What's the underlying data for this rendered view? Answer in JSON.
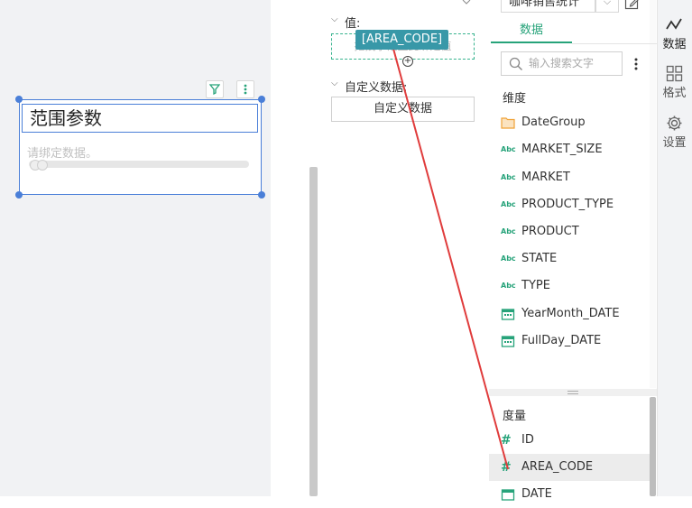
{
  "canvas": {
    "widget_title": "范围参数",
    "widget_placeholder": "请绑定数据。"
  },
  "binding_panel": {
    "value_label": "值:",
    "dropzone_placeholder": "拖拽字段至此绑定值",
    "custom_data_label": "自定义数据:",
    "custom_data_button": "自定义数据",
    "drag_chip": "[AREA_CODE]"
  },
  "data_panel": {
    "dataset": "咖啡销售统计",
    "tab_data": "数据",
    "search_placeholder": "输入搜索文字",
    "dimensions_header": "维度",
    "dimensions": [
      {
        "name": "DateGroup",
        "icon": "folder-icon"
      },
      {
        "name": "MARKET_SIZE",
        "icon": "abc-icon"
      },
      {
        "name": "MARKET",
        "icon": "abc-icon"
      },
      {
        "name": "PRODUCT_TYPE",
        "icon": "abc-icon"
      },
      {
        "name": "PRODUCT",
        "icon": "abc-icon"
      },
      {
        "name": "STATE",
        "icon": "abc-icon"
      },
      {
        "name": "TYPE",
        "icon": "abc-icon"
      },
      {
        "name": "YearMonth_DATE",
        "icon": "calendar-icon"
      },
      {
        "name": "FullDay_DATE",
        "icon": "calendar-icon"
      }
    ],
    "measures_header": "度量",
    "measures": [
      {
        "name": "ID",
        "icon": "hash-icon"
      },
      {
        "name": "AREA_CODE",
        "icon": "hash-icon",
        "selected": true
      },
      {
        "name": "DATE",
        "icon": "calendar-icon"
      }
    ],
    "abc_glyph": "Abc",
    "hash_glyph": "#"
  },
  "side_tabs": [
    {
      "label": "数据",
      "icon": "chart-line-icon",
      "active": true
    },
    {
      "label": "格式",
      "icon": "grid-icon"
    },
    {
      "label": "设置",
      "icon": "gear-icon"
    }
  ],
  "colors": {
    "accent": "#27a37a",
    "selection": "#4a7fd8",
    "drag_chip": "#3898a8",
    "arrow": "#e03c3c"
  }
}
